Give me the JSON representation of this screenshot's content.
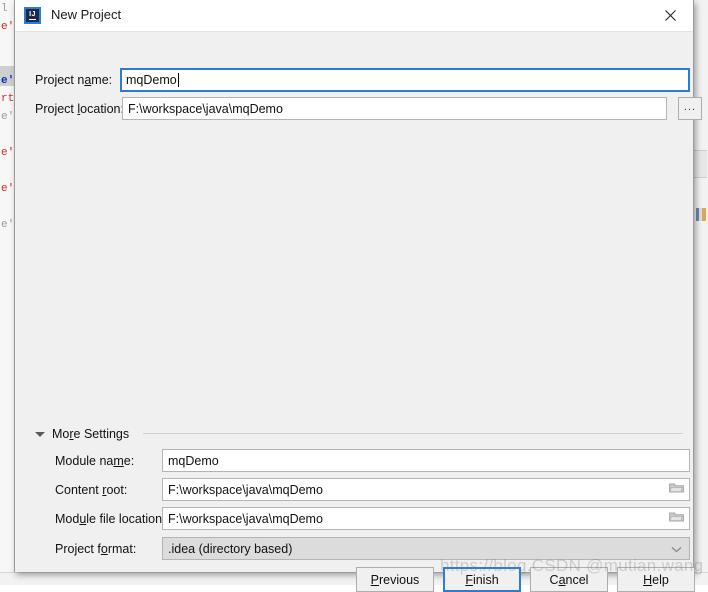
{
  "window": {
    "title": "New Project",
    "app_icon": "intellij-idea-icon",
    "icon_label": "IJ",
    "close_label": "✕"
  },
  "fields": {
    "project_name": {
      "label_before": "Project n",
      "label_mnemonic": "a",
      "label_after": "me:",
      "value": "mqDemo",
      "focused": true
    },
    "project_location": {
      "label_before": "Project ",
      "label_mnemonic": "l",
      "label_after": "ocation:",
      "value": "F:\\workspace\\java\\mqDemo",
      "browse_label": "..."
    }
  },
  "more_settings": {
    "title_before": "Mo",
    "title_mnemonic": "r",
    "title_after": "e Settings",
    "expanded": true,
    "rows": [
      {
        "label_before": "Module na",
        "label_mnemonic": "m",
        "label_after": "e:",
        "value": "mqDemo",
        "type": "text",
        "icon": null
      },
      {
        "label_before": "Content ",
        "label_mnemonic": "r",
        "label_after": "oot:",
        "value": "F:\\workspace\\java\\mqDemo",
        "type": "text",
        "icon": "folder-icon"
      },
      {
        "label_before": "Mod",
        "label_mnemonic": "u",
        "label_after": "le file location:",
        "value": "F:\\workspace\\java\\mqDemo",
        "type": "text",
        "icon": "folder-icon"
      },
      {
        "label_before": "Project f",
        "label_mnemonic": "o",
        "label_after": "rmat:",
        "value": ".idea (directory based)",
        "type": "combo",
        "icon": "chevron-down-icon"
      }
    ]
  },
  "buttons": [
    {
      "before": "",
      "mnemonic": "P",
      "after": "revious",
      "default": false
    },
    {
      "before": "",
      "mnemonic": "F",
      "after": "inish",
      "default": true
    },
    {
      "before": "C",
      "mnemonic": "a",
      "after": "ncel",
      "default": false
    },
    {
      "before": "",
      "mnemonic": "H",
      "after": "elp",
      "default": false
    }
  ],
  "watermark": {
    "text": "https://blog.CSDN  @mutian.wang"
  },
  "background_editor": {
    "lines": [
      "e'",
      "",
      "e'",
      "rt",
      "e'",
      "",
      "e'",
      "",
      "e'",
      "",
      "e'"
    ]
  },
  "colors": {
    "accent": "#2b7cd3",
    "dialog_bg": "#f0f0f0",
    "titlebar_bg": "#ffffff",
    "field_bg": "#ffffff",
    "combo_bg": "#dcdcdc",
    "border": "#b4b4b4"
  }
}
